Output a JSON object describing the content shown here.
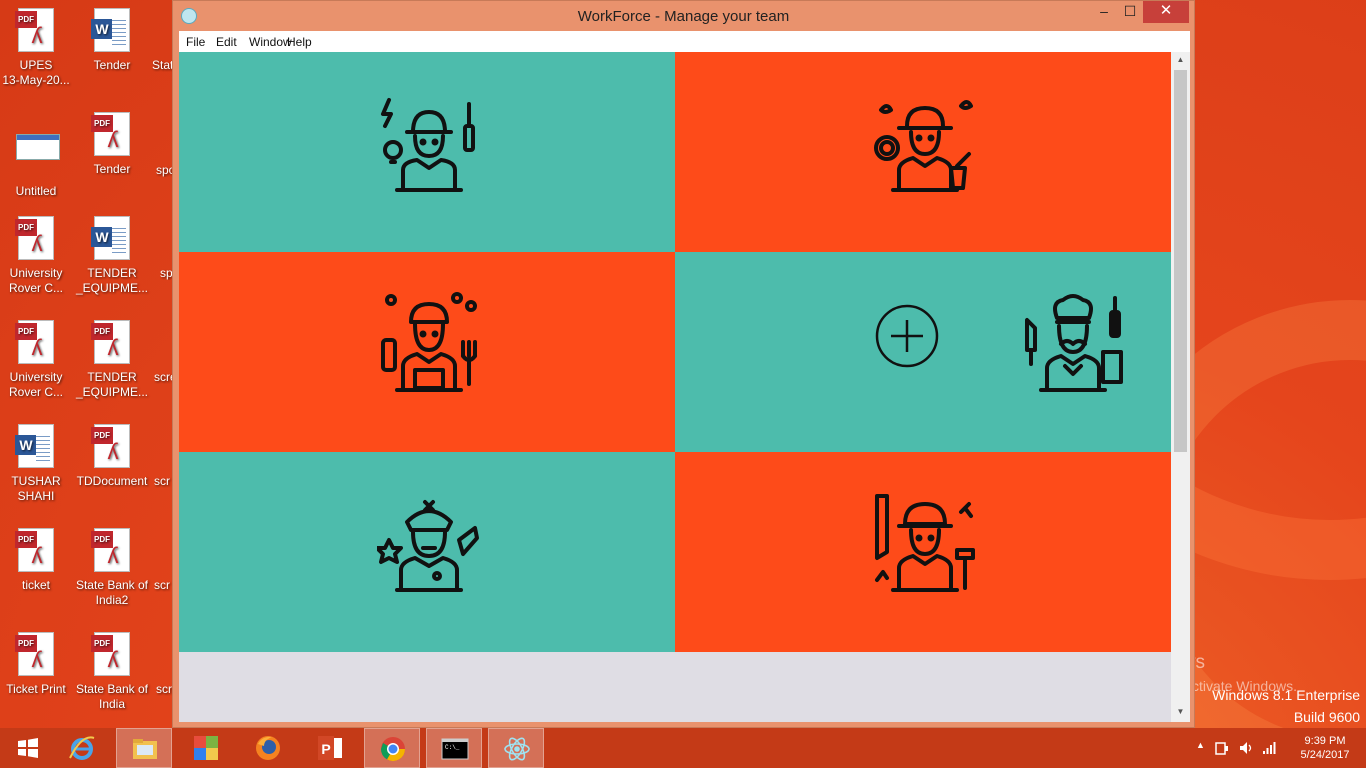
{
  "window": {
    "title": "WorkForce - Manage your team",
    "controls": {
      "minimize": "–",
      "maximize": "☐",
      "close": "✕"
    }
  },
  "menubar": [
    "File",
    "Edit",
    "Window",
    "Help"
  ],
  "tiles": [
    {
      "worker": "electrician",
      "color": "#4dbcac"
    },
    {
      "worker": "gardener",
      "color": "#fe4b19"
    },
    {
      "worker": "cook",
      "color": "#fe4b19"
    },
    {
      "worker": "chef",
      "color": "#4dbcac"
    },
    {
      "worker": "police-officer",
      "color": "#4dbcac"
    },
    {
      "worker": "carpenter",
      "color": "#fe4b19"
    }
  ],
  "desktop_icons": [
    {
      "label": "UPES\n13-May-20...",
      "type": "pdf"
    },
    {
      "label": "Tender",
      "type": "word"
    },
    {
      "label": "Untitled",
      "type": "window"
    },
    {
      "label": "Tender",
      "type": "pdf"
    },
    {
      "label": "University\nRover C...",
      "type": "pdf"
    },
    {
      "label": "TENDER\n_EQUIPME...",
      "type": "word"
    },
    {
      "label": "University\nRover C...",
      "type": "pdf"
    },
    {
      "label": "TENDER\n_EQUIPME...",
      "type": "pdf"
    },
    {
      "label": "TUSHAR\nSHAHI",
      "type": "word"
    },
    {
      "label": "TDDocument",
      "type": "pdf"
    },
    {
      "label": "ticket",
      "type": "pdf"
    },
    {
      "label": "State Bank of\nIndia2",
      "type": "pdf"
    },
    {
      "label": "Ticket Print",
      "type": "pdf"
    },
    {
      "label": "State Bank of\nIndia",
      "type": "pdf"
    }
  ],
  "partial_labels": [
    "Stat",
    "spo",
    "sp",
    "scre",
    "scr",
    "scr",
    "scr"
  ],
  "activation": {
    "title": "Activate Windows",
    "subtitle": "Go to PC settings to activate Windows."
  },
  "edition": {
    "name": "Windows 8.1 Enterprise",
    "build": "Build 9600"
  },
  "taskbar": {
    "apps": [
      "windows-start",
      "internet-explorer",
      "file-explorer",
      "windows-store",
      "firefox",
      "powerpoint",
      "chrome",
      "command-prompt",
      "electron-app"
    ],
    "clock": {
      "time": "9:39 PM",
      "date": "5/24/2017"
    }
  },
  "colors": {
    "teal": "#4dbcac",
    "orange": "#fe4b19",
    "desktop": "#e5451c",
    "taskbar": "#c43a17"
  }
}
